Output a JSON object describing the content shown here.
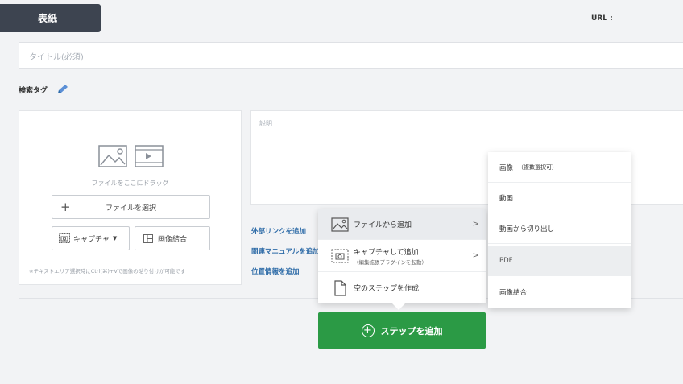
{
  "cover_tab": "表紙",
  "url_label": "URL :",
  "title_placeholder": "タイトル(必須)",
  "tags": {
    "label": "検索タグ",
    "icon": "pencil-icon"
  },
  "media": {
    "drag_hint": "ファイルをここにドラッグ",
    "select_file": "ファイルを選択",
    "capture": "キャプチャ",
    "merge": "画像結合",
    "hint": "※テキストエリア選択時にCtrl(⌘)+Vで画像の貼り付けが可能です"
  },
  "description_placeholder": "説明",
  "links": {
    "external": "外部リンクを追加",
    "related": "関連マニュアルを追加",
    "location": "位置情報を追加"
  },
  "add_step": "ステップを追加",
  "menu": {
    "from_file": "ファイルから追加",
    "capture_add": "キャプチャして追加",
    "capture_sub": "（編集拡張プラグインを起動）",
    "empty_step": "空のステップを作成",
    "chevron": ">"
  },
  "submenu": {
    "image": "画像",
    "image_note": "（複数選択可）",
    "video": "動画",
    "video_clip": "動画から切り出し",
    "pdf": "PDF",
    "image_merge": "画像結合"
  },
  "colors": {
    "primary": "#2b9a45",
    "tab": "#3d4450",
    "link": "#2f6ca8"
  }
}
